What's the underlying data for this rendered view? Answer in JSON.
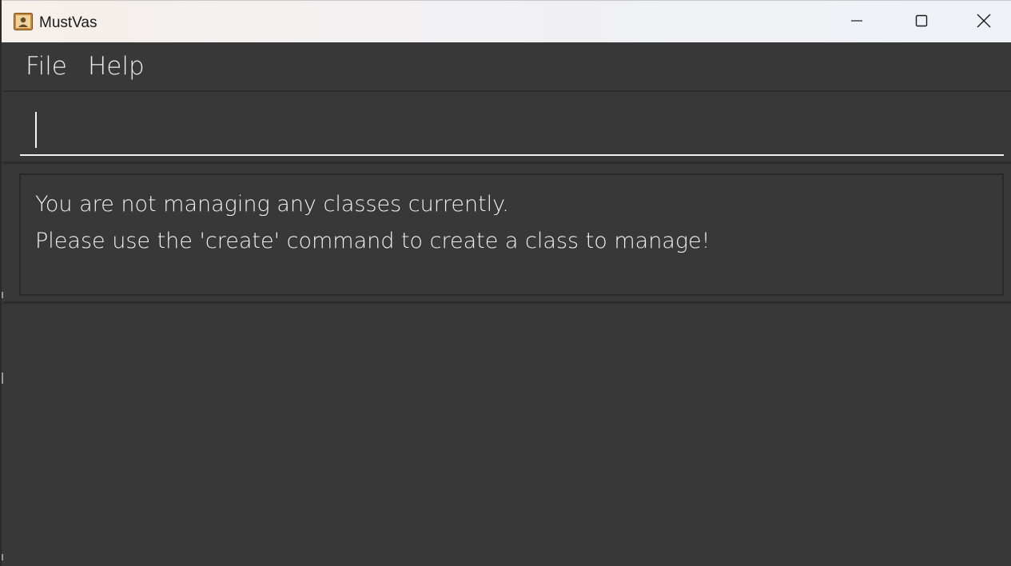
{
  "window": {
    "title": "MustVas",
    "icon": "address-book-icon"
  },
  "controls": {
    "minimize_icon": "minimize-icon",
    "maximize_icon": "maximize-icon",
    "close_icon": "close-icon"
  },
  "menu": {
    "items": [
      {
        "label": "File"
      },
      {
        "label": "Help"
      }
    ]
  },
  "command": {
    "value": "",
    "placeholder": ""
  },
  "result": {
    "lines": [
      "You are not managing any classes currently.",
      "Please use the 'create' command to create a class to manage!"
    ]
  },
  "colors": {
    "background": "#383838",
    "divider": "#2c2c2c",
    "text": "#f0f0f0",
    "titlebar": "#f1f0f2"
  }
}
